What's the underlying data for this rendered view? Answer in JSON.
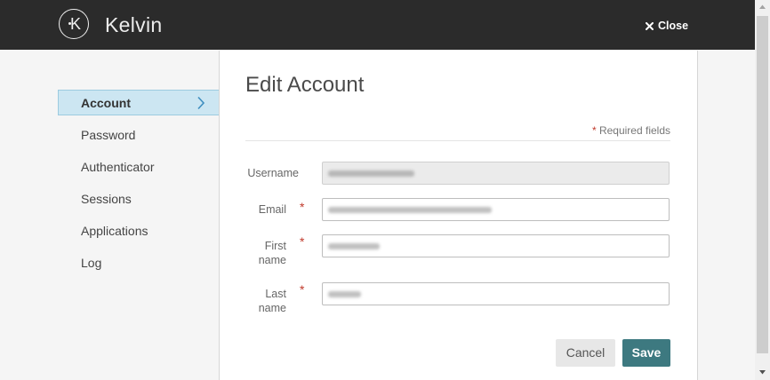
{
  "app": {
    "name": "Kelvin",
    "logo_letter": "K"
  },
  "header": {
    "close_label": "Close",
    "close_icon": "close-icon"
  },
  "sidebar": {
    "items": [
      {
        "label": "Account",
        "selected": true,
        "icon": "chevron-right-icon"
      },
      {
        "label": "Password",
        "selected": false
      },
      {
        "label": "Authenticator",
        "selected": false
      },
      {
        "label": "Sessions",
        "selected": false
      },
      {
        "label": "Applications",
        "selected": false
      },
      {
        "label": "Log",
        "selected": false
      }
    ]
  },
  "form": {
    "title": "Edit Account",
    "required_marker": "*",
    "required_note": "Required fields",
    "fields": [
      {
        "label": "Username",
        "required": false,
        "disabled": true
      },
      {
        "label": "Email",
        "required": true,
        "disabled": false
      },
      {
        "label": "First name",
        "required": true,
        "disabled": false
      },
      {
        "label": "Last name",
        "required": true,
        "disabled": false
      }
    ],
    "buttons": {
      "cancel": "Cancel",
      "save": "Save"
    }
  },
  "colors": {
    "header_bg": "#2b2b2b",
    "accent": "#3d7980",
    "selected_bg": "#cce6f2",
    "required": "#c0392b"
  }
}
